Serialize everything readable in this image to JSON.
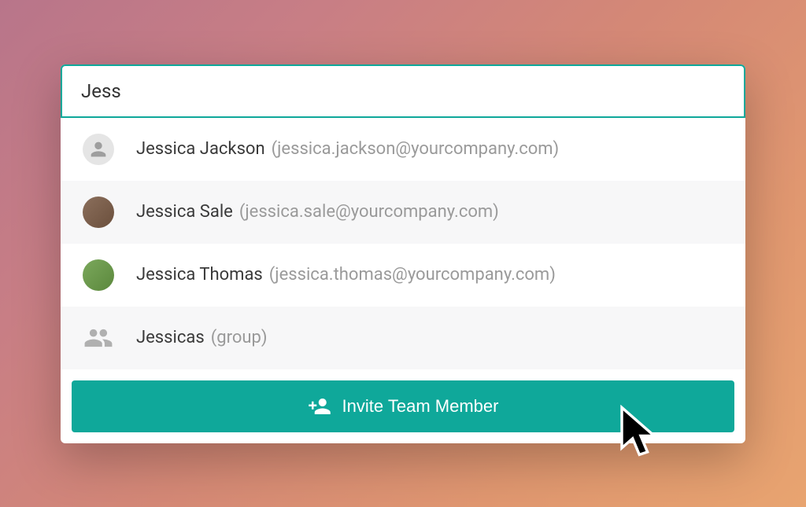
{
  "search": {
    "value": "Jess"
  },
  "results": [
    {
      "name": "Jessica Jackson",
      "detail": "(jessica.jackson@yourcompany.com)",
      "avatar_type": "placeholder"
    },
    {
      "name": "Jessica Sale",
      "detail": "(jessica.sale@yourcompany.com)",
      "avatar_type": "photo"
    },
    {
      "name": "Jessica Thomas",
      "detail": "(jessica.thomas@yourcompany.com)",
      "avatar_type": "photo"
    },
    {
      "name": "Jessicas",
      "detail": "(group)",
      "avatar_type": "group"
    }
  ],
  "button": {
    "invite_label": "Invite Team Member"
  },
  "colors": {
    "accent": "#0fa89a"
  }
}
